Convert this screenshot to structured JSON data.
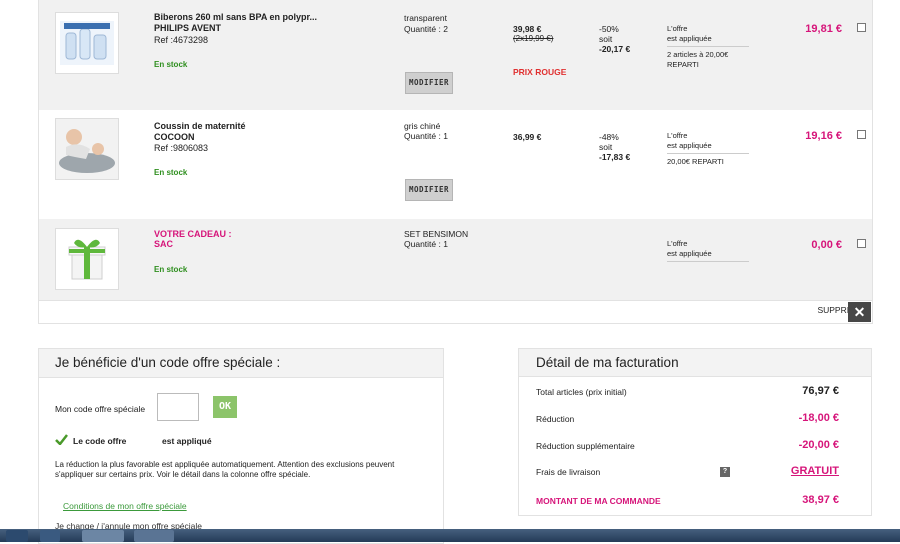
{
  "cart": {
    "items": [
      {
        "name": "Biberons 260 ml sans BPA en polypr...",
        "brand": "PHILIPS AVENT",
        "ref": "Ref :4673298",
        "stock": "En stock",
        "option": "transparent",
        "quantity": "Quantité : 2",
        "modify_label": "MODIFIER",
        "price": "39,98 €",
        "price_old": "(2x19,99 €)",
        "badge": "PRIX ROUGE",
        "discount_pct": "-50%",
        "discount_soit": "soit",
        "discount_amount": "-20,17 €",
        "offer_line1": "L'offre",
        "offer_line2": "est appliquée",
        "offer_detail1": "2 articles à 20,00€",
        "offer_detail2": "REPARTI",
        "total": "19,81 €"
      },
      {
        "name": "Coussin de maternité",
        "brand": "COCOON",
        "ref": "Ref :9806083",
        "stock": "En stock",
        "option": "gris chiné",
        "quantity": "Quantité : 1",
        "modify_label": "MODIFIER",
        "price": "36,99 €",
        "discount_pct": "-48%",
        "discount_soit": "soit",
        "discount_amount": "-17,83 €",
        "offer_line1": "L'offre",
        "offer_line2": "est appliquée",
        "offer_detail1": "20,00€ REPARTI",
        "total": "19,16 €"
      },
      {
        "name": "VOTRE CADEAU :",
        "brand": "SAC",
        "stock": "En stock",
        "option": "SET BENSIMON",
        "quantity": "Quantité : 1",
        "offer_line1": "L'offre",
        "offer_line2": "est appliquée",
        "total": "0,00 €"
      }
    ],
    "delete_label": "SUPPRIMER",
    "close_glyph": "✕"
  },
  "promo": {
    "title": "Je bénéficie d'un code offre spéciale :",
    "code_label": "Mon code offre spéciale",
    "code_value": "",
    "ok_label": "OK",
    "applied_prefix": "Le code offre",
    "applied_suffix": "est appliqué",
    "notice": "La réduction la plus favorable est appliquée automatiquement. Attention des exclusions peuvent s'appliquer sur certains prix. Voir le détail dans la colonne offre spéciale.",
    "conditions_link": "Conditions de mon offre spéciale",
    "change_link": "Je change / j'annule mon offre spéciale"
  },
  "billing": {
    "title": "Détail de ma facturation",
    "rows": [
      {
        "label": "Total articles (prix initial)",
        "value": "76,97 €"
      },
      {
        "label": "Réduction",
        "value": "-18,00 €"
      },
      {
        "label": "Réduction supplémentaire",
        "value": "-20,00 €"
      },
      {
        "label": "Frais de livraison",
        "value": "GRATUIT"
      },
      {
        "label": "MONTANT DE MA COMMANDE",
        "value": "38,97 €"
      }
    ],
    "help_glyph": "?"
  },
  "colors": {
    "accent_pink": "#d6157a",
    "stock_green": "#2f8f1f",
    "prix_rouge": "#e03030",
    "ok_green": "#8cc46a"
  }
}
